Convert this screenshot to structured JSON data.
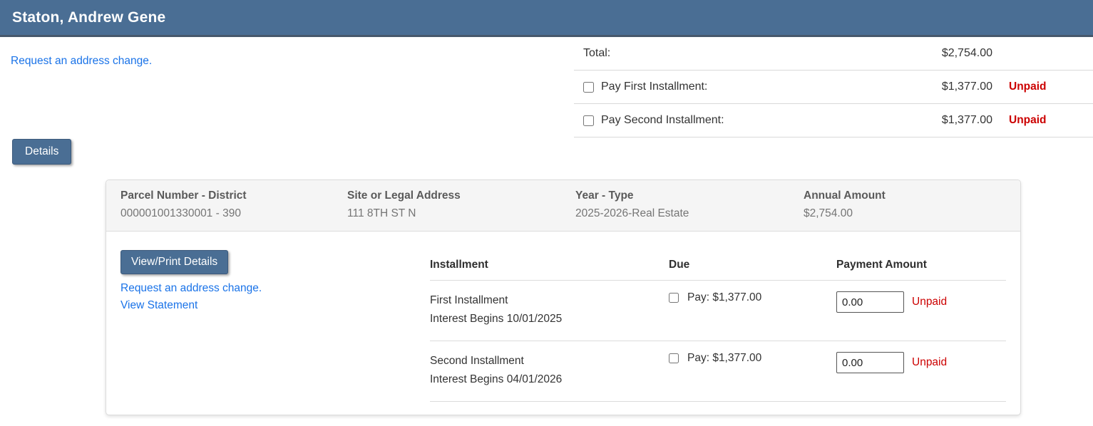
{
  "colors": {
    "accent": "#4a6e94",
    "link": "#1a73e8",
    "unpaid": "#cc0000",
    "card_header_bg": "#f5f5f5"
  },
  "header": {
    "title": "Staton, Andrew Gene"
  },
  "summary": {
    "address_change_link": "Request an address change.",
    "total_row": {
      "label": "Total:",
      "amount": "$2,754.00"
    },
    "installment_rows": [
      {
        "label": "Pay First Installment:",
        "amount": "$1,377.00",
        "status": "Unpaid"
      },
      {
        "label": "Pay Second Installment:",
        "amount": "$1,377.00",
        "status": "Unpaid"
      }
    ]
  },
  "details_button_label": "Details",
  "card": {
    "info": [
      {
        "label": "Parcel Number - District",
        "value": "000001001330001 - 390"
      },
      {
        "label": "Site or Legal Address",
        "value": "111 8TH ST N"
      },
      {
        "label": "Year - Type",
        "value": "2025-2026-Real Estate"
      },
      {
        "label": "Annual Amount",
        "value": "$2,754.00"
      }
    ],
    "actions": {
      "view_print_button": "View/Print Details",
      "address_change_link": "Request an address change.",
      "view_statement_link": "View Statement"
    },
    "table": {
      "headers": [
        "Installment",
        "Due",
        "Payment Amount"
      ],
      "rows": [
        {
          "name": "First Installment",
          "note": "Interest Begins 10/01/2025",
          "due": "Pay: $1,377.00",
          "payment_value": "0.00",
          "status": "Unpaid"
        },
        {
          "name": "Second Installment",
          "note": "Interest Begins 04/01/2026",
          "due": "Pay: $1,377.00",
          "payment_value": "0.00",
          "status": "Unpaid"
        }
      ]
    }
  }
}
